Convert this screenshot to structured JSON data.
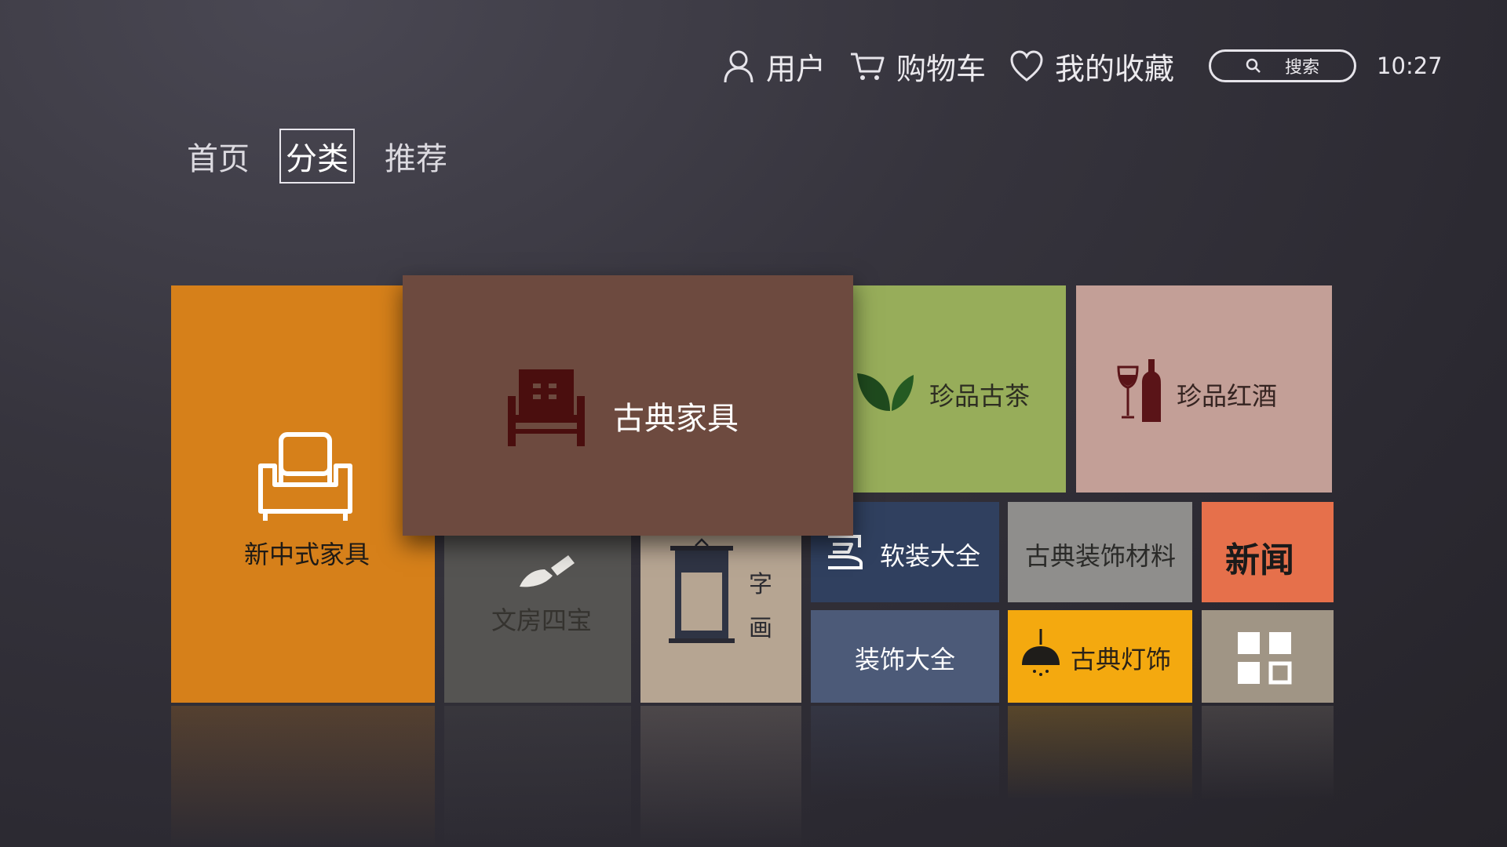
{
  "header": {
    "user_label": "用户",
    "cart_label": "购物车",
    "favorites_label": "我的收藏",
    "search_placeholder": "搜索",
    "time": "10:27"
  },
  "tabs": [
    {
      "label": "首页"
    },
    {
      "label": "分类",
      "active": true
    },
    {
      "label": "推荐"
    }
  ],
  "tiles": {
    "new_chinese_furniture": "新中式家具",
    "classical_furniture": "古典家具",
    "tea": "珍品古茶",
    "wine": "珍品红酒",
    "study_treasures": "文房四宝",
    "calligraphy_char1": "字",
    "calligraphy_char2": "画",
    "soft_furnishing": "软装大全",
    "decoration_materials": "古典装饰材料",
    "news": "新闻",
    "decoration": "装饰大全",
    "classical_lamps": "古典灯饰"
  },
  "colors": {
    "orange": "#d6801a",
    "brown": "#6d4a3f",
    "green": "#97ad5a",
    "pink": "#c39f97",
    "dark_gray": "#555452",
    "beige": "#b6a592",
    "navy": "#30405f",
    "light_gray": "#8f8e8c",
    "coral": "#e6704b",
    "slate": "#4c5a78",
    "amber": "#f4a90f",
    "taupe": "#a09585"
  }
}
